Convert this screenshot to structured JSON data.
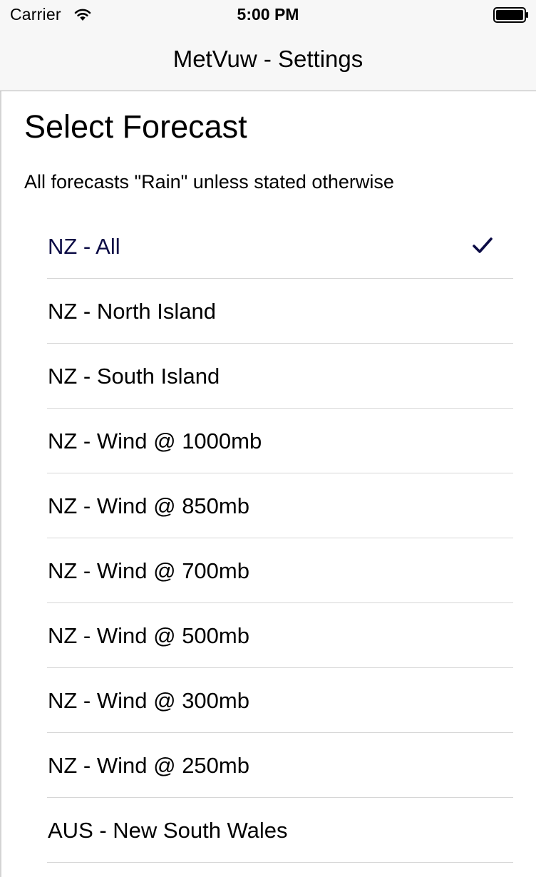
{
  "status_bar": {
    "carrier": "Carrier",
    "time": "5:00 PM",
    "icons": [
      "wifi-icon",
      "battery-icon"
    ]
  },
  "nav_bar": {
    "title": "MetVuw - Settings"
  },
  "section": {
    "heading": "Select Forecast",
    "subtitle": "All forecasts \"Rain\" unless stated otherwise"
  },
  "forecasts": [
    {
      "label": "NZ - All",
      "selected": true
    },
    {
      "label": "NZ - North Island",
      "selected": false
    },
    {
      "label": "NZ - South Island",
      "selected": false
    },
    {
      "label": "NZ - Wind @ 1000mb",
      "selected": false
    },
    {
      "label": "NZ - Wind @ 850mb",
      "selected": false
    },
    {
      "label": "NZ - Wind @ 700mb",
      "selected": false
    },
    {
      "label": "NZ - Wind @ 500mb",
      "selected": false
    },
    {
      "label": "NZ - Wind @ 300mb",
      "selected": false
    },
    {
      "label": "NZ - Wind @ 250mb",
      "selected": false
    },
    {
      "label": "AUS - New South Wales",
      "selected": false
    }
  ],
  "colors": {
    "chrome_background": "#f7f7f7",
    "selected_text": "#0b0b45",
    "separator": "#d6d6d6"
  }
}
